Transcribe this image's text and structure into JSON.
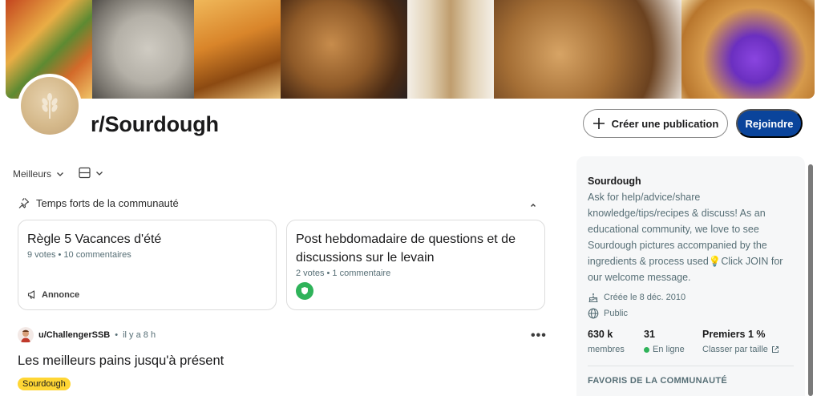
{
  "banner": {
    "tiles": [
      {
        "name": "banner-tile-herb-focaccia",
        "colors": [
          "#b93c1a",
          "#e7a53c",
          "#4f7b2a"
        ]
      },
      {
        "name": "banner-tile-scored-dough",
        "colors": [
          "#9d9a93",
          "#c9c6bd",
          "#6e6b66"
        ]
      },
      {
        "name": "banner-tile-olive-focaccia",
        "colors": [
          "#d9892a",
          "#8c4a12",
          "#f1c36a"
        ]
      },
      {
        "name": "banner-tile-round-loaf",
        "colors": [
          "#6b3d17",
          "#b27c3f",
          "#2d2420"
        ]
      },
      {
        "name": "banner-tile-crumb-halves",
        "colors": [
          "#e6d7bf",
          "#c9b08a",
          "#8d7250"
        ]
      },
      {
        "name": "banner-tile-boule-closeup",
        "colors": [
          "#8a5a2b",
          "#cf9a5c",
          "#4b2f18"
        ]
      },
      {
        "name": "banner-tile-ube-croissant",
        "colors": [
          "#e2b36a",
          "#7c3bd6",
          "#b8762d"
        ]
      }
    ]
  },
  "community": {
    "name": "r/Sourdough",
    "avatar_icon": "wheat-icon"
  },
  "actions": {
    "create_label": "Créer une publication",
    "join_label": "Rejoindre"
  },
  "feed": {
    "sort_label": "Meilleurs"
  },
  "highlights": {
    "title": "Temps forts de la communauté",
    "cards": [
      {
        "title": "Règle 5 Vacances d'été",
        "meta": "9 votes • 10 commentaires",
        "footer": "Annonce"
      },
      {
        "title": "Post hebdomadaire de questions et de discussions sur le levain",
        "meta": "2 votes • 1 commentaire"
      }
    ]
  },
  "post": {
    "author": "u/ChallengerSSB",
    "separator": "•",
    "time": "il y a 8 h",
    "title": "Les meilleurs pains jusqu'à présent",
    "flair": "Sourdough",
    "more": "•••"
  },
  "sidebar": {
    "name": "Sourdough",
    "description": "Ask for help/advice/share knowledge/tips/recipes & discuss! As an educational community, we love to see Sourdough pictures accompanied by the ingredients & process used💡Click JOIN for our welcome message.",
    "created": "Créée le 8 déc. 2010",
    "visibility": "Public",
    "stats": {
      "members_value": "630 k",
      "members_label": "membres",
      "online_value": "31",
      "online_label": "En ligne",
      "rank_value": "Premiers 1 %",
      "rank_label": "Classer par taille"
    },
    "favorites_title": "FAVORIS DE LA COMMUNAUTÉ"
  },
  "colors": {
    "join_bg": "#0a449b",
    "flair_bg": "#ffd635",
    "online": "#2fb35a"
  }
}
